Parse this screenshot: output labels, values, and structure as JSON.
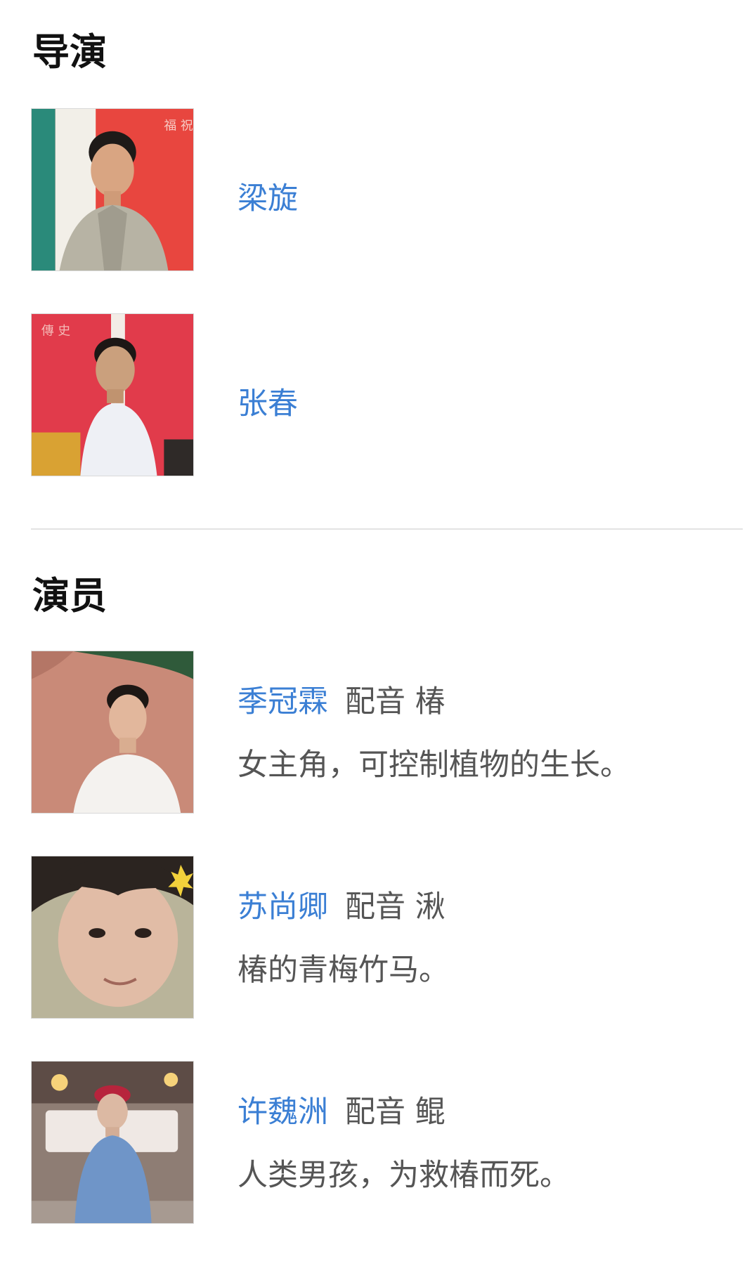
{
  "directors": {
    "title": "导演",
    "people": [
      {
        "name": "梁旋",
        "photo_icon": "director-photo-icon"
      },
      {
        "name": "张春",
        "photo_icon": "director-photo-icon"
      }
    ]
  },
  "actors": {
    "title": "演员",
    "people": [
      {
        "name": "季冠霖",
        "role": "配音 椿",
        "description": "女主角，可控制植物的生长。"
      },
      {
        "name": "苏尚卿",
        "role": "配音 湫",
        "description": "椿的青梅竹马。"
      },
      {
        "name": "许魏洲",
        "role": "配音 鲲",
        "description": "人类男孩，为救椿而死。"
      }
    ]
  },
  "colors": {
    "link": "#3b7fd4",
    "heading": "#111111",
    "body_text": "#555555",
    "divider": "#e3e3e3"
  }
}
